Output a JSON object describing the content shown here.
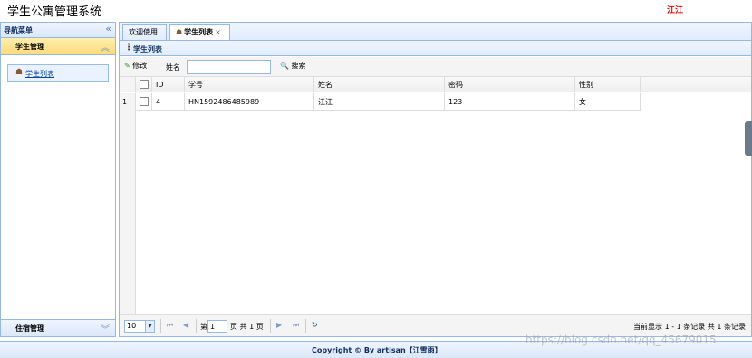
{
  "header": {
    "app_title": "学生公寓管理系统",
    "user_name": "江江"
  },
  "nav": {
    "title": "导航菜单",
    "collapse_icon": "double-chevron-left-icon",
    "sections": [
      {
        "title": "学生管理",
        "expanded": true,
        "items": [
          {
            "label": "学生列表",
            "icon": "user-icon"
          }
        ]
      },
      {
        "title": "住宿管理",
        "expanded": false,
        "items": []
      }
    ]
  },
  "tabs": [
    {
      "label": "欢迎使用",
      "active": false
    },
    {
      "label": "学生列表",
      "active": true,
      "closable": true
    }
  ],
  "panel": {
    "title": "学生列表"
  },
  "toolbar": {
    "edit_label": "修改",
    "search_label": "姓名",
    "search_value": "",
    "search_button": "搜索"
  },
  "grid": {
    "columns": [
      "ID",
      "学号",
      "姓名",
      "密码",
      "性别"
    ],
    "rows": [
      {
        "row_number": "1",
        "id": "4",
        "student_no": "HN1592486485989",
        "name": "江江",
        "password": "123",
        "gender": "女"
      }
    ]
  },
  "pager": {
    "page_size": "10",
    "page_prefix": "第",
    "page_value": "1",
    "page_suffix": "页 共 1 页",
    "info": "当前显示 1 - 1 条记录 共 1 条记录"
  },
  "footer": {
    "text": "Copyright © By artisan【江雪雨】"
  },
  "watermark": "https://blog.csdn.net/qq_45679015",
  "colors": {
    "border": "#95b8e7",
    "accordion_active": "#fbdc7a",
    "user_name": "#ee0000"
  }
}
